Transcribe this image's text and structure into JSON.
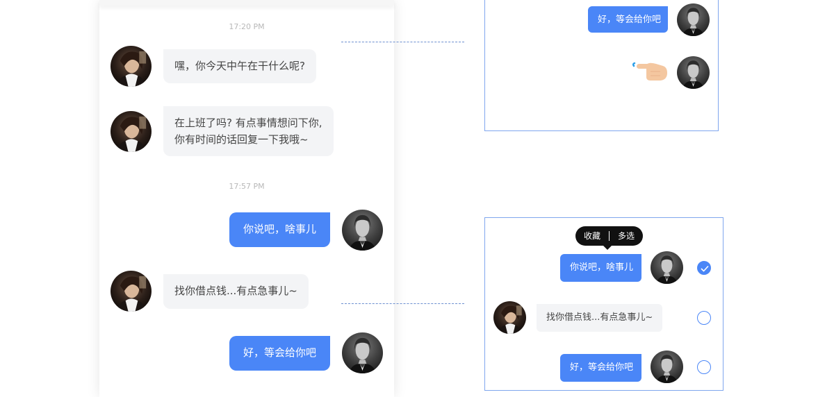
{
  "chat": {
    "times": [
      "17:20 PM",
      "17:57 PM"
    ],
    "messages": [
      {
        "side": "in",
        "lines": [
          "嘿，你今天中午在干什么呢?"
        ]
      },
      {
        "side": "in",
        "lines": [
          "在上班了吗? 有点事情想问下你,",
          "你有时间的话回复一下我哦~"
        ]
      },
      {
        "side": "out",
        "lines": [
          "你说吧，啥事儿"
        ]
      },
      {
        "side": "in",
        "lines": [
          "找你借点钱...有点急事儿~"
        ]
      },
      {
        "side": "out",
        "lines": [
          "好，等会给你吧"
        ]
      }
    ]
  },
  "detail_top": {
    "message": "好，等会给你吧",
    "gesture_icon": "hand-pointer-press-icon"
  },
  "detail_bottom": {
    "menu": [
      "收藏",
      "多选"
    ],
    "messages": [
      {
        "side": "out",
        "text": "你说吧，啥事儿",
        "selected": true
      },
      {
        "side": "in",
        "text": "找你借点钱...有点急事儿~",
        "selected": false
      },
      {
        "side": "out",
        "text": "好，等会给你吧",
        "selected": false
      }
    ]
  },
  "colors": {
    "accent": "#4a86f7",
    "bubble_in": "#f3f4f6",
    "frame_border": "#7fa6ee",
    "menu_bg": "#111111"
  }
}
